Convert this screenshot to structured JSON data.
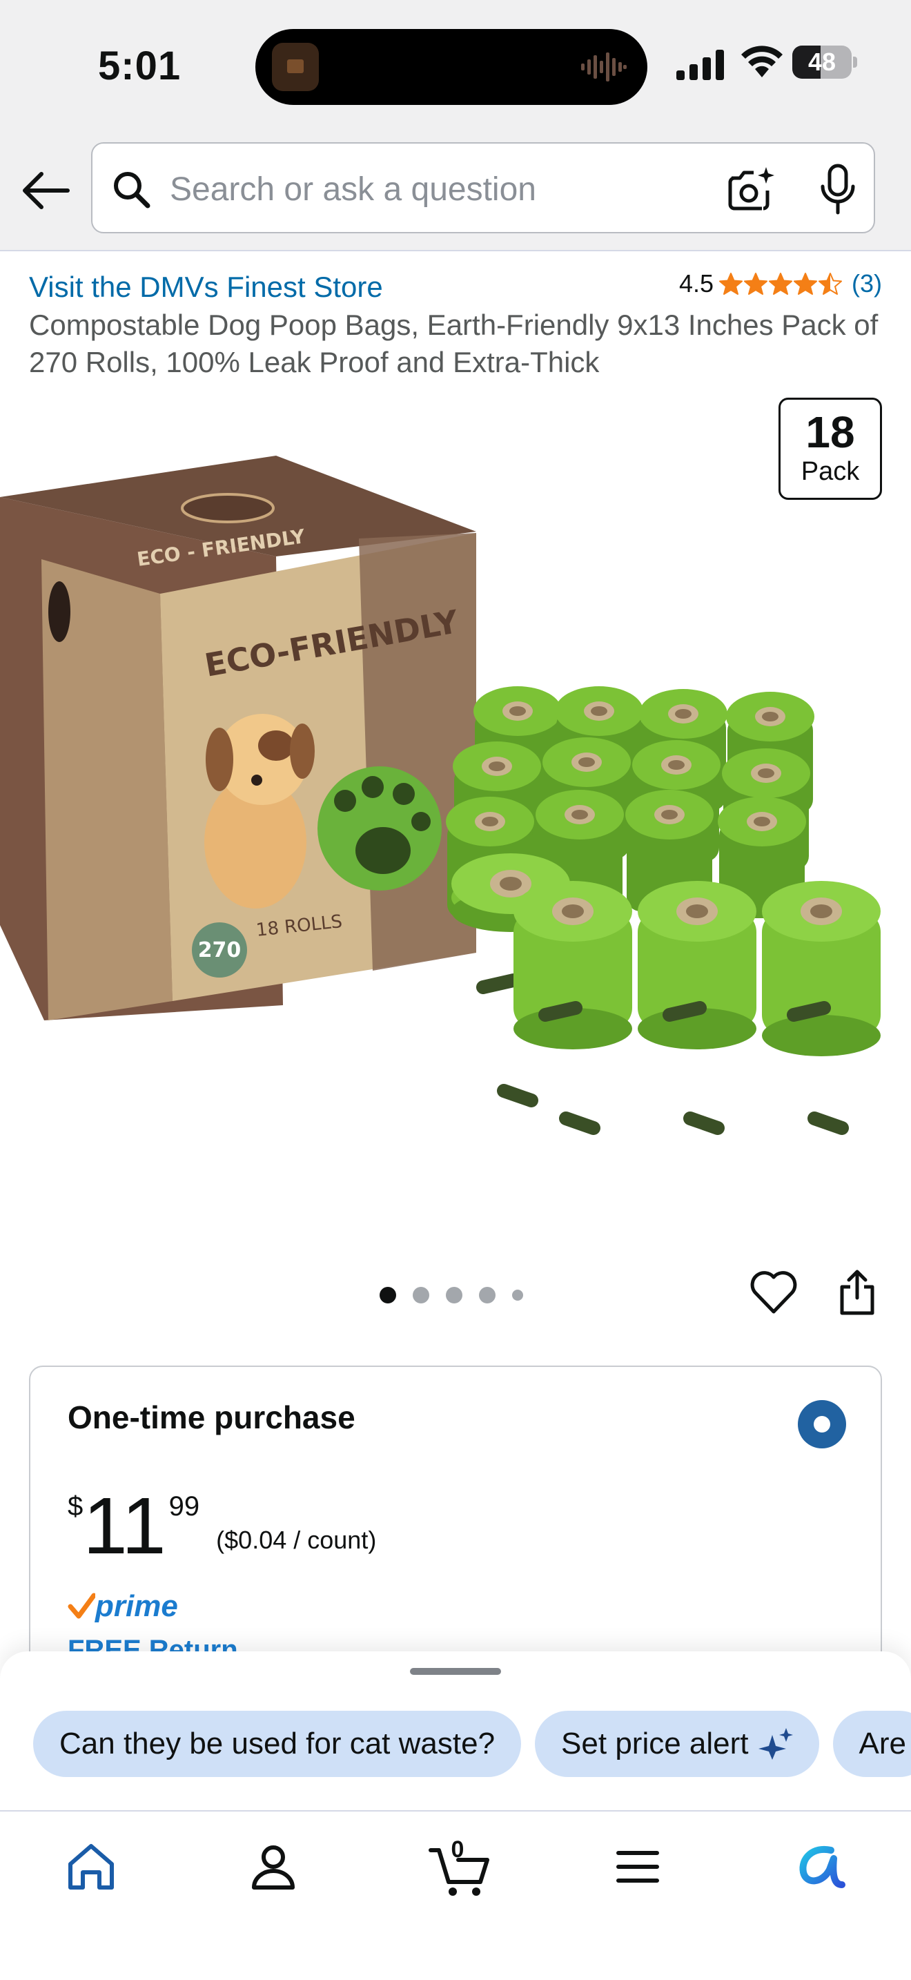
{
  "status_bar": {
    "time": "5:01",
    "battery_level": "48",
    "battery_fraction": 0.48
  },
  "header": {
    "back_icon": "arrow-left-icon",
    "search_placeholder": "Search or ask a question",
    "camera_icon": "camera-lens-icon",
    "mic_icon": "microphone-icon"
  },
  "product": {
    "store_link": "Visit the DMVs Finest Store",
    "rating": "4.5",
    "rating_value": 4.5,
    "review_count": "(3)",
    "title": "Compostable Dog Poop Bags, Earth-Friendly 9x13 Inches Pack of 270 Rolls, 100% Leak Proof and Extra-Thick",
    "badge_number": "18",
    "badge_label": "Pack",
    "image_box_text_brand": "ECO-FRIENDLY",
    "image_box_count": "270",
    "image_box_rolls": "18 ROLLS",
    "image_dots": {
      "total": 5,
      "active": 1
    }
  },
  "purchase": {
    "option_title": "One-time purchase",
    "price_symbol": "$",
    "price_whole": "11",
    "price_fraction": "99",
    "price_per_unit": "($0.04 / count)",
    "prime_label": "prime",
    "delivery_text": "FREE Return"
  },
  "suggestions": [
    {
      "label": "Can they be used for cat waste?"
    },
    {
      "label": "Set price alert",
      "icon": "sparkle-icon"
    },
    {
      "label": "Are"
    }
  ],
  "tabbar": {
    "cart_count": "0",
    "tabs": [
      "home-icon",
      "account-icon",
      "cart-icon",
      "menu-icon",
      "rufus-ai-icon"
    ]
  },
  "colors": {
    "link": "#006aa8",
    "star": "#f47f16",
    "prime_blue": "#1b7ccf",
    "radio_selected": "#2162a1",
    "chip_bg": "#cfe0f7",
    "bag_green": "#7cc236"
  }
}
